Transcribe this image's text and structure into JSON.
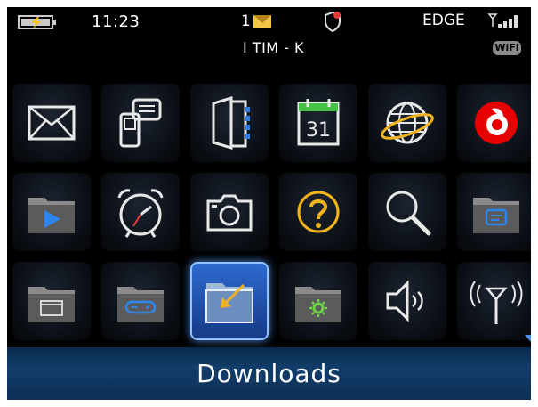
{
  "status": {
    "time": "11:23",
    "message_count": "1",
    "carrier": "I TIM - K",
    "network": "EDGE",
    "wifi_badge": "WiFi"
  },
  "icons": [
    {
      "name": "messages-icon"
    },
    {
      "name": "instant-messaging-icon"
    },
    {
      "name": "contacts-icon"
    },
    {
      "name": "calendar-icon",
      "text": "31"
    },
    {
      "name": "browser-icon"
    },
    {
      "name": "vodafone-icon"
    },
    {
      "name": "media-folder-icon"
    },
    {
      "name": "clock-icon"
    },
    {
      "name": "camera-icon"
    },
    {
      "name": "help-icon"
    },
    {
      "name": "search-icon"
    },
    {
      "name": "im-folder-icon"
    },
    {
      "name": "applications-folder-icon"
    },
    {
      "name": "games-folder-icon"
    },
    {
      "name": "downloads-folder-icon"
    },
    {
      "name": "settings-folder-icon"
    },
    {
      "name": "sound-profiles-icon"
    },
    {
      "name": "manage-connections-icon"
    }
  ],
  "selected_label": "Downloads",
  "colors": {
    "accent": "#4d8fe8",
    "bar": "#123d6a"
  }
}
